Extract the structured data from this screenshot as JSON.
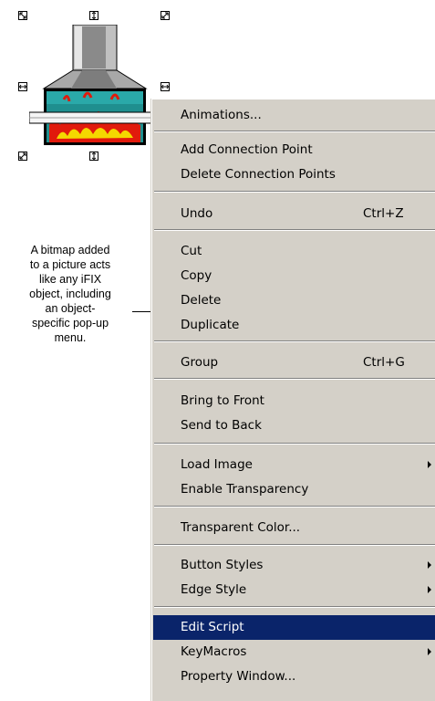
{
  "caption": {
    "lines": [
      "A bitmap added",
      "to a picture acts",
      "like any iFIX",
      "object, including",
      "an object-",
      "specific pop-up",
      "menu."
    ]
  },
  "menu": {
    "animations": "Animations...",
    "add_connection_point": "Add Connection Point",
    "delete_connection_points": "Delete Connection Points",
    "undo": "Undo",
    "undo_shortcut": "Ctrl+Z",
    "cut": "Cut",
    "copy": "Copy",
    "delete": "Delete",
    "duplicate": "Duplicate",
    "group": "Group",
    "group_shortcut": "Ctrl+G",
    "bring_to_front": "Bring to Front",
    "send_to_back": "Send to Back",
    "load_image": "Load Image",
    "enable_transparency": "Enable Transparency",
    "transparent_color": "Transparent Color...",
    "button_styles": "Button Styles",
    "edge_style": "Edge Style",
    "edit_script": "Edit Script",
    "key_macros": "KeyMacros",
    "property_window": "Property Window..."
  },
  "colors": {
    "menu_bg": "#d4d0c8",
    "highlight": "#0a246a",
    "fire_red": "#e11a0c",
    "fire_yellow": "#f4d800",
    "firebox_teal": "#1f8f8f"
  }
}
